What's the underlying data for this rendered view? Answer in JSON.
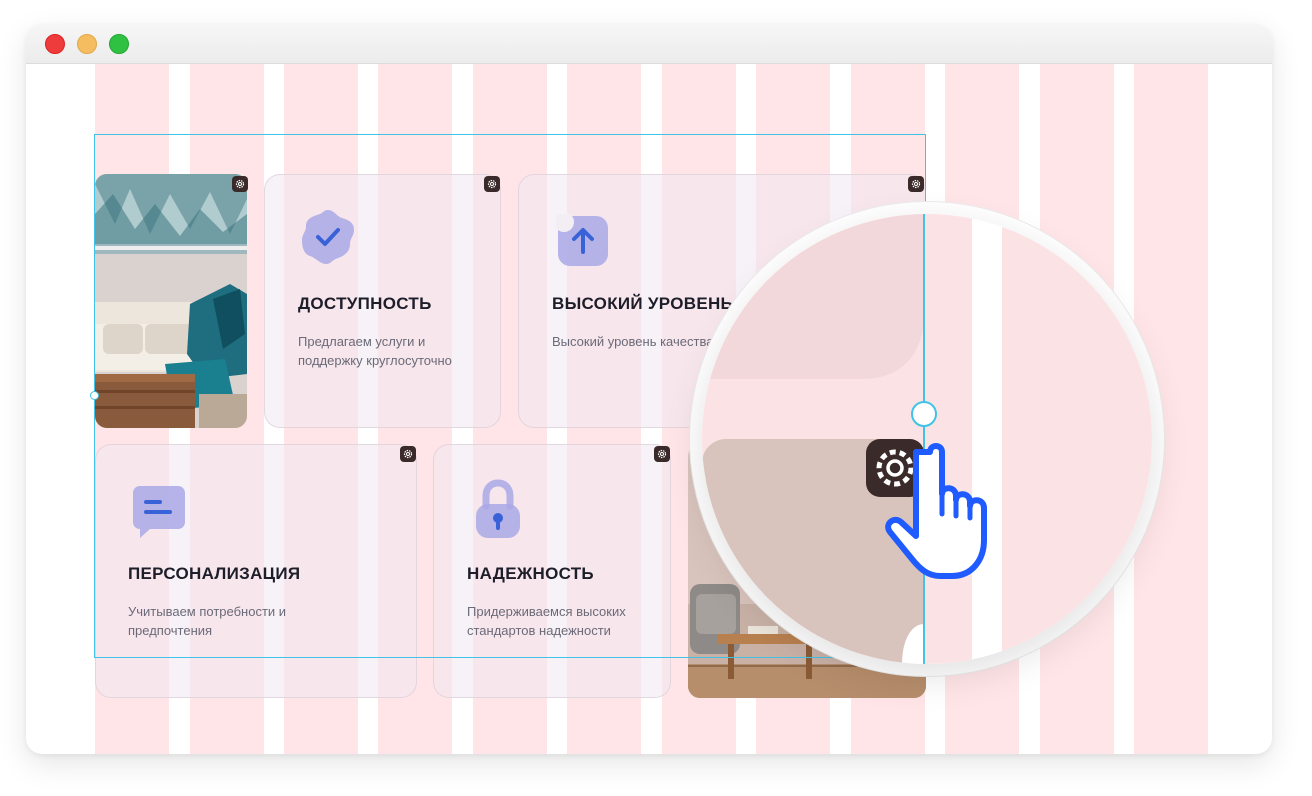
{
  "window": {
    "controls": [
      "close",
      "minimize",
      "maximize"
    ]
  },
  "cards": [
    {
      "title": "ДОСТУПНОСТЬ",
      "description": "Предлагаем услуги и поддержку круглосуточно",
      "icon": "badge-check-icon"
    },
    {
      "title": "ВЫСОКИЙ УРОВЕНЬ",
      "description": "Высокий уровень качества",
      "icon": "arrow-up-square-icon"
    },
    {
      "title": "ПЕРСОНАЛИЗАЦИЯ",
      "description": "Учитываем потребности и предпочтения",
      "icon": "chat-bubble-icon"
    },
    {
      "title": "НАДЕЖНОСТЬ",
      "description": "Придерживаемся высоких стандартов надежности",
      "icon": "lock-icon"
    }
  ],
  "colors": {
    "grid_column": "#ffc0c6",
    "selection": "#3fc4e8",
    "icon_lavender": "#a9a8e6",
    "icon_blue": "#3a62d8",
    "cursor_blue": "#1f5bff"
  }
}
